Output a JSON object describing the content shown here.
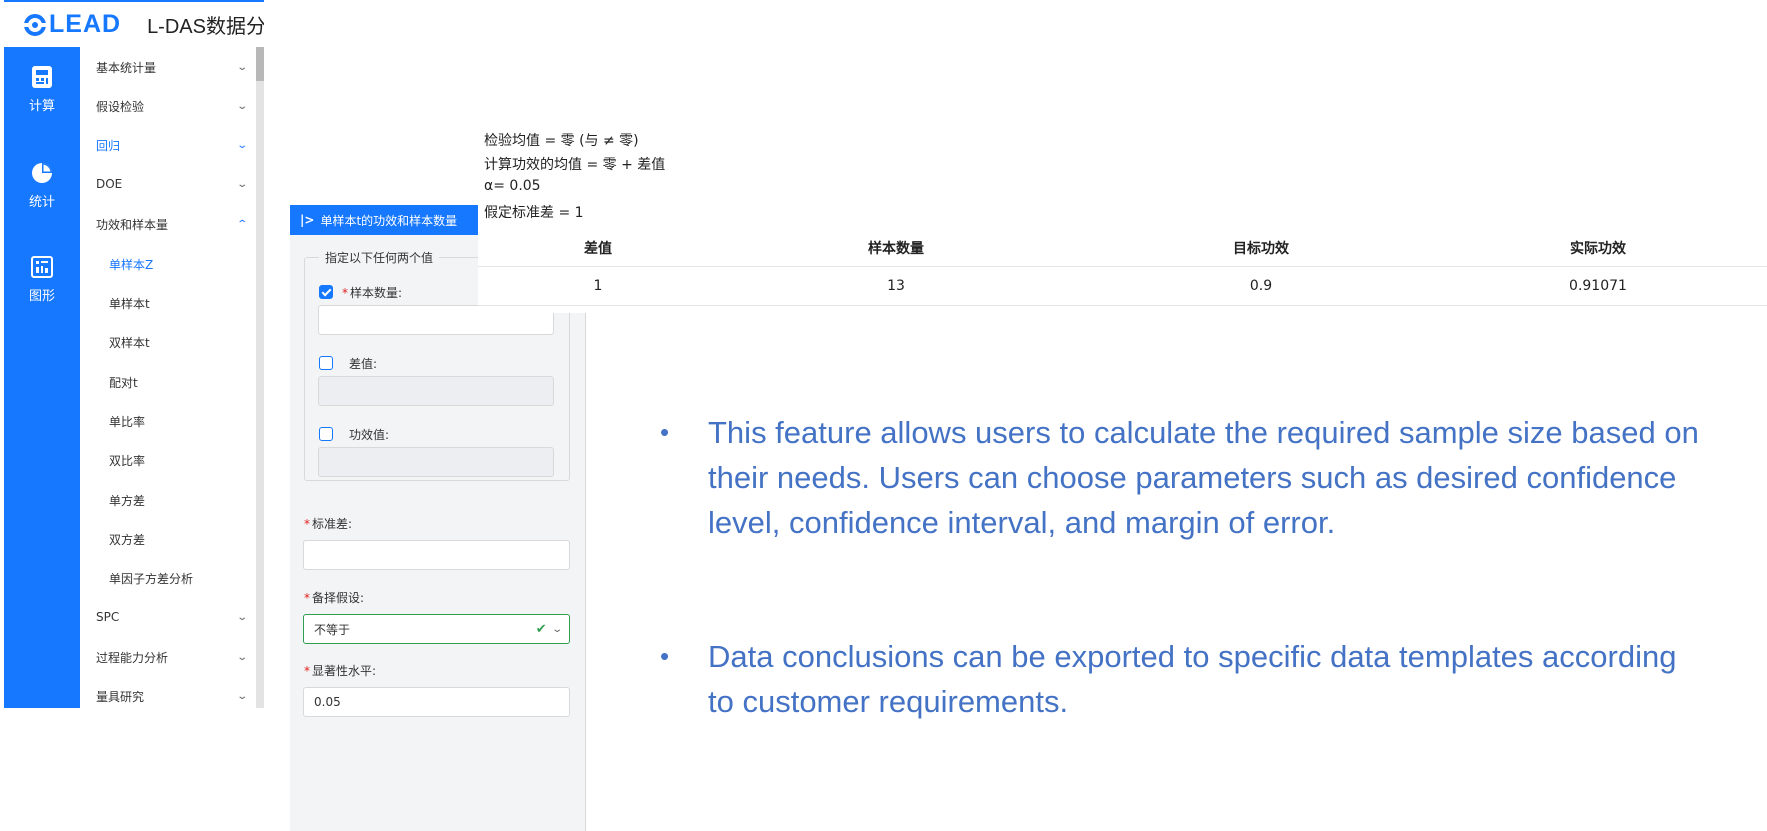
{
  "app": {
    "logo_text": "LEAD",
    "title": "L-DAS数据分"
  },
  "rail": [
    {
      "label": "计算",
      "icon": "calculator-icon"
    },
    {
      "label": "统计",
      "icon": "pie-chart-icon"
    },
    {
      "label": "图形",
      "icon": "chart-board-icon"
    }
  ],
  "menu": {
    "items": [
      {
        "label": "基本统计量"
      },
      {
        "label": "假设检验"
      },
      {
        "label": "回归"
      },
      {
        "label": "DOE"
      },
      {
        "label": "功效和样本量"
      }
    ],
    "sub_items": [
      {
        "label": "单样本Z"
      },
      {
        "label": "单样本t"
      },
      {
        "label": "双样本t"
      },
      {
        "label": "配对t"
      },
      {
        "label": "单比率"
      },
      {
        "label": "双比率"
      },
      {
        "label": "单方差"
      },
      {
        "label": "双方差"
      },
      {
        "label": "单因子方差分析"
      }
    ],
    "items_after": [
      {
        "label": "SPC"
      },
      {
        "label": "过程能力分析"
      },
      {
        "label": "量具研究"
      }
    ]
  },
  "panel": {
    "title": "单样本t的功效和样本数量",
    "group_legend": "指定以下任何两个值",
    "sample_size_label": "样本数量:",
    "difference_label": "差值:",
    "power_label": "功效值:",
    "std_label": "标准差:",
    "alt_label": "备择假设:",
    "alt_value": "不等于",
    "alpha_label": "显著性水平:",
    "alpha_value": "0.05",
    "required_mark": "*"
  },
  "output": {
    "lines": [
      "检验均值 = 零 (与 ≠ 零)",
      "计算功效的均值 = 零 + 差值",
      "α= 0.05",
      "假定标准差 = 1"
    ],
    "table": {
      "headers": [
        "差值",
        "样本数量",
        "目标功效",
        "实际功效"
      ],
      "rows": [
        [
          "1",
          "13",
          "0.9",
          "0.91071"
        ]
      ]
    }
  },
  "bullets": [
    "This feature allows users to calculate the required sample size based on their needs. Users can choose parameters such as desired confidence level, confidence interval, and margin of error.",
    "Data conclusions can be exported to specific data templates according to customer requirements."
  ],
  "colors": {
    "brand": "#1677ff",
    "bullet_text": "#4472c4",
    "valid_green": "#2e9e4f"
  }
}
